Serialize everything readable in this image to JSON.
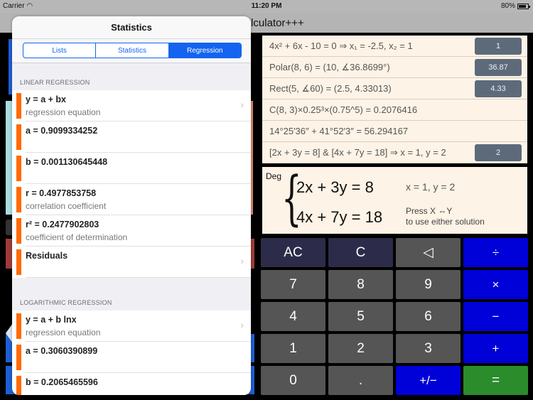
{
  "status_bar": {
    "carrier": "Carrier",
    "wifi_icon": "wifi-icon",
    "time": "11:20 PM",
    "battery_percent": "80%",
    "battery_icon": "battery-icon"
  },
  "nav_bar": {
    "title": "s Calculator+++"
  },
  "history": [
    {
      "expression": "4x² + 6x - 10 = 0      ⇒      x₁ = -2.5, x₂ = 1",
      "chip": "1"
    },
    {
      "expression": "Polar(8, 6) = (10, ∡36.8699°)",
      "chip": "36.87"
    },
    {
      "expression": "Rect(5, ∡60) = (2.5, 4.33013)",
      "chip": "4.33"
    },
    {
      "expression": "C(8, 3)×0.25³×(0.75^5) = 0.2076416",
      "chip": null
    },
    {
      "expression": "14°25′36″ + 41°52′3″ = 56.294167",
      "chip": null
    },
    {
      "expression": "[2x + 3y = 8]  &  [4x + 7y = 18] ⇒ x = 1, y = 2",
      "chip": "2"
    }
  ],
  "display": {
    "mode": "Deg",
    "equation1": "2x + 3y = 8",
    "equation2": "4x + 7y = 18",
    "solution": "x = 1, y = 2",
    "hint_line1": "Press X ⇔Y",
    "hint_line2": "to use either solution"
  },
  "keypad": {
    "keys": [
      {
        "label": "AC",
        "type": "clear",
        "name": "all-clear-key"
      },
      {
        "label": "C",
        "type": "clear",
        "name": "clear-key"
      },
      {
        "label": "◁",
        "type": "num",
        "name": "backspace-key"
      },
      {
        "label": "÷",
        "type": "op",
        "name": "divide-key"
      },
      {
        "label": "7",
        "type": "num",
        "name": "digit-7-key"
      },
      {
        "label": "8",
        "type": "num",
        "name": "digit-8-key"
      },
      {
        "label": "9",
        "type": "num",
        "name": "digit-9-key"
      },
      {
        "label": "×",
        "type": "op",
        "name": "multiply-key"
      },
      {
        "label": "4",
        "type": "num",
        "name": "digit-4-key"
      },
      {
        "label": "5",
        "type": "num",
        "name": "digit-5-key"
      },
      {
        "label": "6",
        "type": "num",
        "name": "digit-6-key"
      },
      {
        "label": "−",
        "type": "op",
        "name": "subtract-key"
      },
      {
        "label": "1",
        "type": "num",
        "name": "digit-1-key"
      },
      {
        "label": "2",
        "type": "num",
        "name": "digit-2-key"
      },
      {
        "label": "3",
        "type": "num",
        "name": "digit-3-key"
      },
      {
        "label": "+",
        "type": "op",
        "name": "add-key"
      },
      {
        "label": "0",
        "type": "num",
        "name": "digit-0-key"
      },
      {
        "label": ".",
        "type": "num",
        "name": "decimal-key"
      },
      {
        "label": "+/−",
        "type": "op",
        "name": "negate-key"
      },
      {
        "label": "=",
        "type": "eq",
        "name": "equals-key"
      }
    ]
  },
  "popover": {
    "title": "Statistics",
    "tabs": [
      {
        "label": "Lists",
        "active": false
      },
      {
        "label": "Statistics",
        "active": false
      },
      {
        "label": "Regression",
        "active": true
      }
    ],
    "sections": [
      {
        "header": "LINEAR REGRESSION",
        "cells": [
          {
            "main": "y = a + bx",
            "sub": "regression equation",
            "chevron": true
          },
          {
            "main": "a = 0.9099334252",
            "sub": "",
            "chevron": false
          },
          {
            "main": "b = 0.001130645448",
            "sub": "",
            "chevron": false
          },
          {
            "main": "r = 0.4977853758",
            "sub": "correlation coefficient",
            "chevron": false
          },
          {
            "main": "r² = 0.2477902803",
            "sub": "coefficient of determination",
            "chevron": false
          },
          {
            "main": "Residuals",
            "sub": "",
            "chevron": true
          }
        ]
      },
      {
        "header": "LOGARITHMIC REGRESSION",
        "cells": [
          {
            "main": "y = a + b lnx",
            "sub": "regression equation",
            "chevron": true
          },
          {
            "main": "a = 0.3060390899",
            "sub": "",
            "chevron": false
          },
          {
            "main": "b = 0.2065465596",
            "sub": "",
            "chevron": false
          }
        ]
      }
    ],
    "chevron_glyph": "›",
    "accent_color": "#1464f0",
    "row_marker_color": "#ff6a00"
  }
}
